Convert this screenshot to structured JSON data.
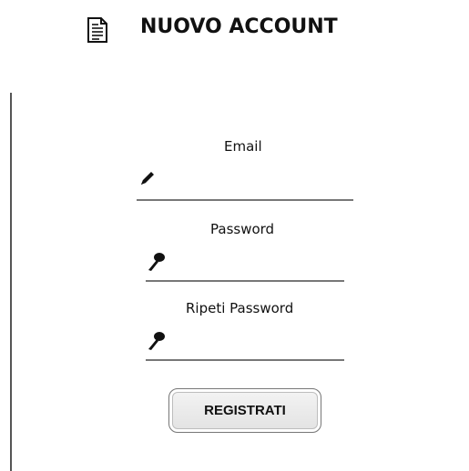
{
  "header": {
    "icon": "document-icon",
    "title": "NUOVO ACCOUNT"
  },
  "form": {
    "email": {
      "label": "Email",
      "icon": "pencil-icon",
      "value": ""
    },
    "password": {
      "label": "Password",
      "icon": "key-icon",
      "value": ""
    },
    "repeat_password": {
      "label": "Ripeti Password",
      "icon": "key-icon",
      "value": ""
    },
    "submit_label": "REGISTRATI"
  }
}
